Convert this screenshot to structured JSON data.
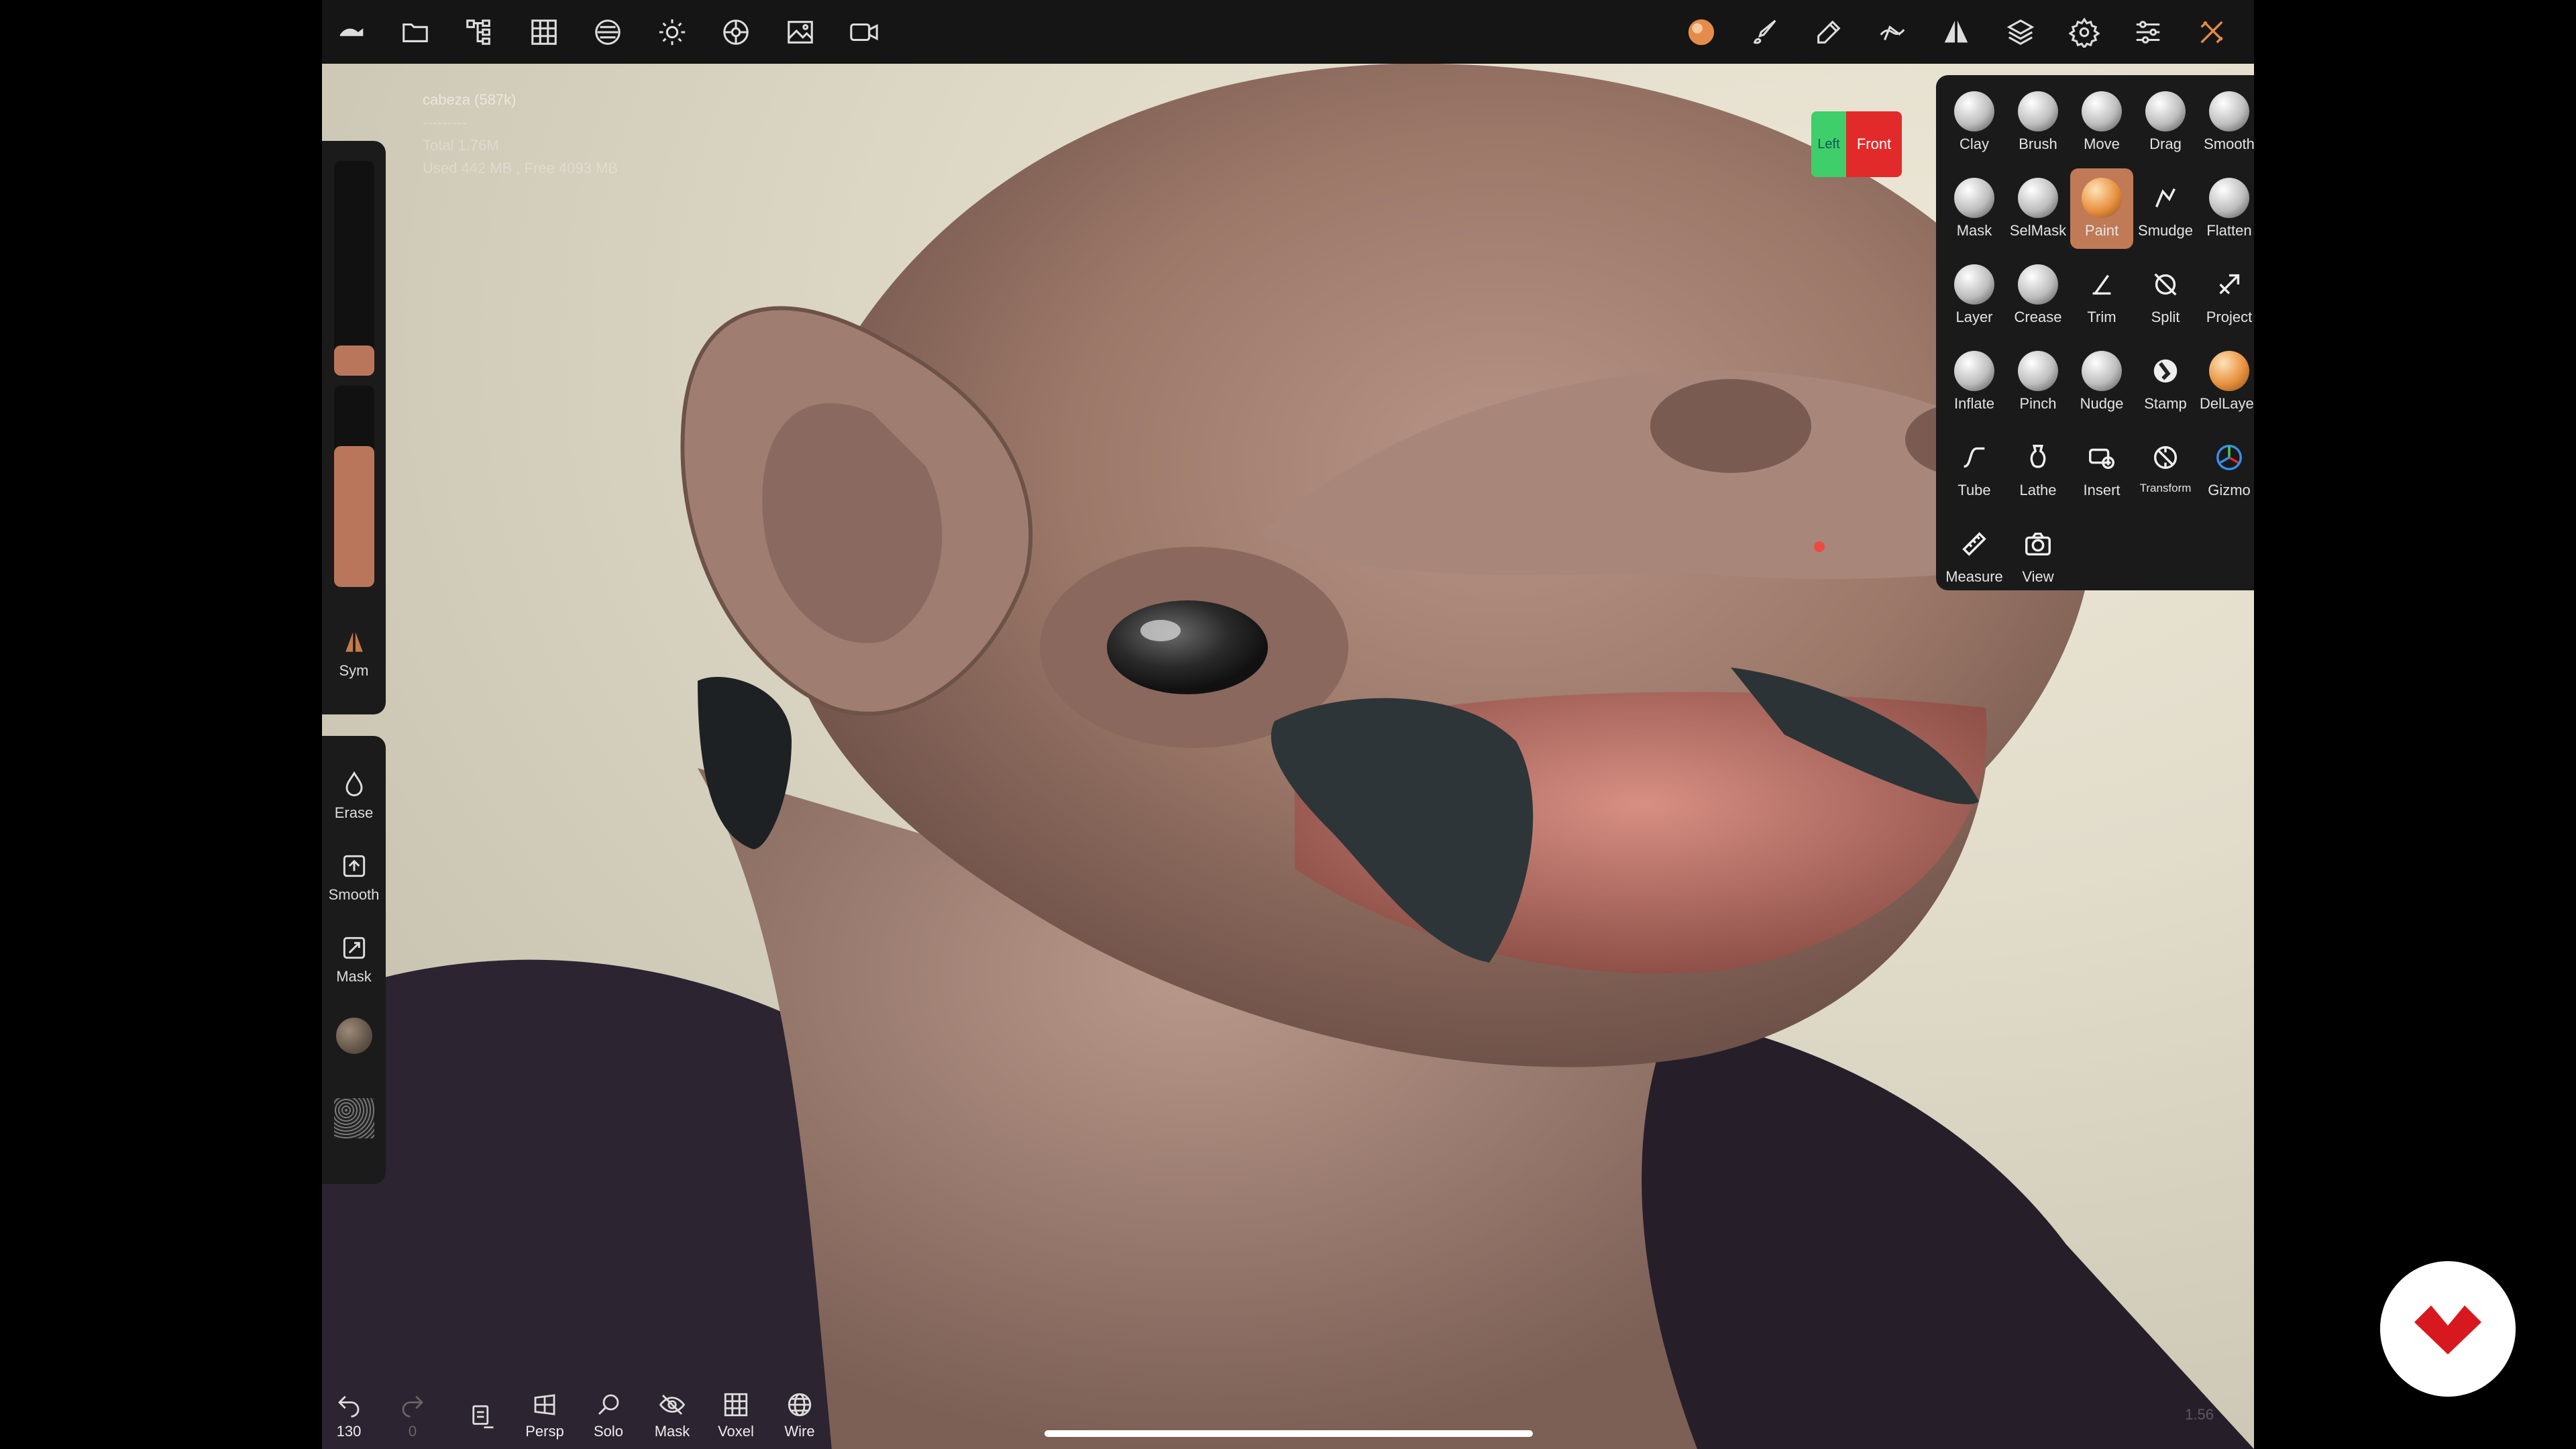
{
  "info": {
    "mesh_name": "cabeza (587k)",
    "separator": "---------",
    "total": "Total 1.76M",
    "memory": "Used 442 MB , Free 4093 MB"
  },
  "topbar": {
    "left_icons": [
      "nomad-logo-icon",
      "folder-icon",
      "scene-tree-icon",
      "grid-icon",
      "material-icon",
      "light-icon",
      "render-settings-icon",
      "image-icon",
      "video-icon"
    ],
    "right_icons": [
      "brush-material-icon",
      "brush-icon",
      "eyedropper-icon",
      "stroke-icon",
      "symmetry-icon",
      "layers-icon",
      "gear-icon",
      "sliders-icon",
      "tools-icon"
    ]
  },
  "left_panel": {
    "sym_label": "Sym",
    "erase_label": "Erase",
    "smooth_label": "Smooth",
    "mask_label": "Mask",
    "brush_color": "#b9765a",
    "size_level": 0.14,
    "intensity_level": 0.7
  },
  "tools": [
    {
      "label": "Clay",
      "icon": "ball"
    },
    {
      "label": "Brush",
      "icon": "ball"
    },
    {
      "label": "Move",
      "icon": "ball"
    },
    {
      "label": "Drag",
      "icon": "ball"
    },
    {
      "label": "Smooth",
      "icon": "ball"
    },
    {
      "label": "Mask",
      "icon": "ball"
    },
    {
      "label": "SelMask",
      "icon": "ball"
    },
    {
      "label": "Paint",
      "icon": "ball-orange",
      "active": true
    },
    {
      "label": "Smudge",
      "icon": "smudge"
    },
    {
      "label": "Flatten",
      "icon": "ball"
    },
    {
      "label": "Layer",
      "icon": "ball"
    },
    {
      "label": "Crease",
      "icon": "ball"
    },
    {
      "label": "Trim",
      "icon": "trim"
    },
    {
      "label": "Split",
      "icon": "split"
    },
    {
      "label": "Project",
      "icon": "project"
    },
    {
      "label": "Inflate",
      "icon": "ball"
    },
    {
      "label": "Pinch",
      "icon": "ball"
    },
    {
      "label": "Nudge",
      "icon": "ball"
    },
    {
      "label": "Stamp",
      "icon": "stamp"
    },
    {
      "label": "DelLayer",
      "icon": "ball-orange"
    },
    {
      "label": "Tube",
      "icon": "tube"
    },
    {
      "label": "Lathe",
      "icon": "lathe"
    },
    {
      "label": "Insert",
      "icon": "insert"
    },
    {
      "label": "Transform",
      "icon": "transform"
    },
    {
      "label": "Gizmo",
      "icon": "gizmo"
    },
    {
      "label": "Measure",
      "icon": "measure"
    },
    {
      "label": "View",
      "icon": "camera"
    }
  ],
  "viewcube": {
    "left": "Left",
    "front": "Front"
  },
  "bottombar": {
    "undo_count": "130",
    "redo_count": "0",
    "persp": "Persp",
    "solo": "Solo",
    "mask": "Mask",
    "voxel": "Voxel",
    "wire": "Wire"
  },
  "version": "1.56",
  "colors": {
    "accent": "#c07a56",
    "panel": "#1a1a1a",
    "skin": "#a88476",
    "logo_red": "#d7191f"
  }
}
